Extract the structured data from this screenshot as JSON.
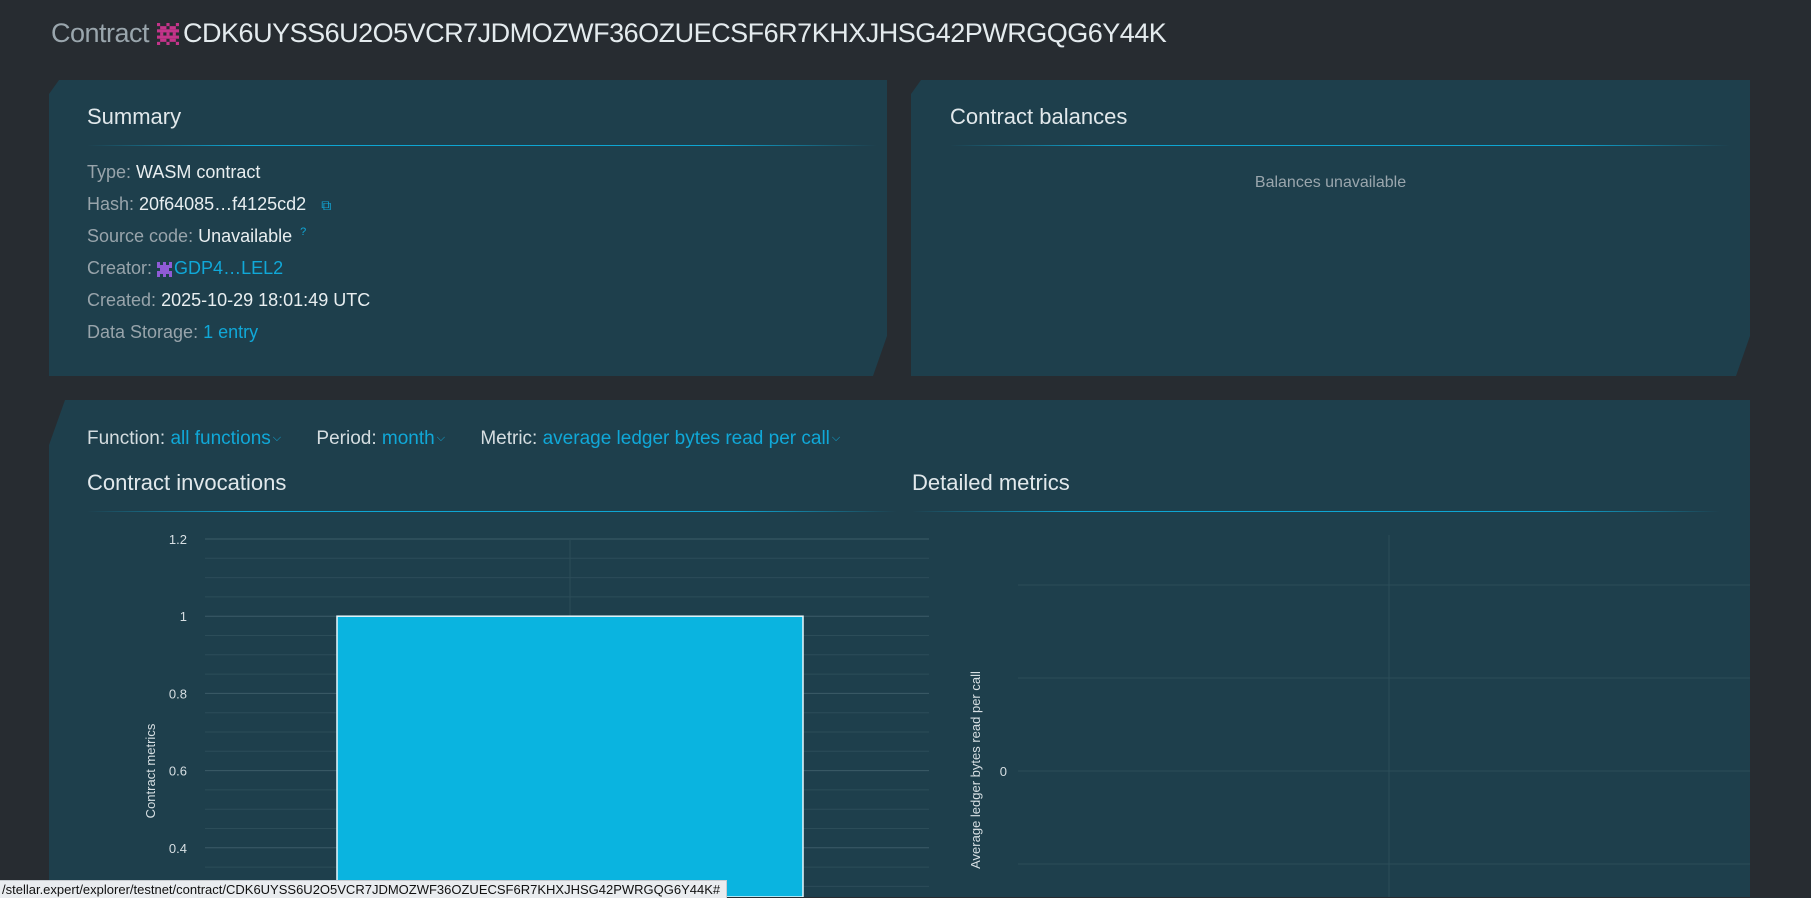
{
  "header": {
    "label": "Contract",
    "address": "CDK6UYSS6U2O5VCR7JDMOZWF36OZUECSF6R7KHXJHSG42PWRGQG6Y44K"
  },
  "summary": {
    "title": "Summary",
    "type_label": "Type:",
    "type_value": "WASM contract",
    "hash_label": "Hash:",
    "hash_value": "20f64085…f4125cd2",
    "source_label": "Source code:",
    "source_value": "Unavailable",
    "creator_label": "Creator:",
    "creator_value": "GDP4…LEL2",
    "created_label": "Created:",
    "created_value": "2025-10-29 18:01:49 UTC",
    "storage_label": "Data Storage:",
    "storage_value": "1 entry",
    "icons": {
      "copy": "copy-icon",
      "help": "help-icon",
      "identicon": "identicon-icon"
    }
  },
  "balances": {
    "title": "Contract balances",
    "empty_text": "Balances unavailable"
  },
  "filters": {
    "function_label": "Function:",
    "function_value": "all functions",
    "period_label": "Period:",
    "period_value": "month",
    "metric_label": "Metric:",
    "metric_value": "average ledger bytes read per call"
  },
  "invocations": {
    "title": "Contract invocations"
  },
  "detailed": {
    "title": "Detailed metrics"
  },
  "chart_data": [
    {
      "type": "bar",
      "title": "Contract invocations",
      "ylabel": "Contract metrics",
      "xlabel": "",
      "categories": [
        ""
      ],
      "values": [
        1
      ],
      "ylim": [
        0,
        1.2
      ],
      "yticks": [
        "1.2",
        "1",
        "0.8",
        "0.6",
        "0.4"
      ],
      "grid": true,
      "color": "#0ab4e0"
    },
    {
      "type": "line",
      "title": "Detailed metrics",
      "ylabel": "Average ledger bytes read per call",
      "yticks": [
        "0"
      ],
      "series": [],
      "grid": true
    }
  ],
  "status_url": "/stellar.expert/explorer/testnet/contract/CDK6UYSS6U2O5VCR7JDMOZWF36OZUECSF6R7KHXJHSG42PWRGQG6Y44K#",
  "colors": {
    "accent": "#10a8d8",
    "panel": "#1e3f4c",
    "background": "#272c31",
    "bar": "#0ab4e0",
    "identicon": "#c4348a"
  }
}
